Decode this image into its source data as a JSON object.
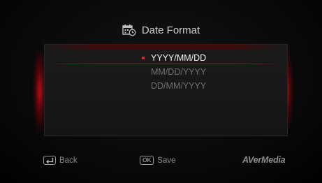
{
  "header": {
    "title": "Date Format",
    "icon": "calendar-clock-icon"
  },
  "options": [
    {
      "label": "YYYY/MM/DD",
      "selected": true
    },
    {
      "label": "MM/DD/YYYY",
      "selected": false
    },
    {
      "label": "DD/MM/YYYY",
      "selected": false
    }
  ],
  "footer": {
    "back_label": "Back",
    "save_key": "OK",
    "save_label": "Save",
    "brand": "AVerMedia"
  },
  "colors": {
    "accent": "#e0202a",
    "selected_text": "#f2f2f2",
    "unselected_text": "#6f7170"
  }
}
